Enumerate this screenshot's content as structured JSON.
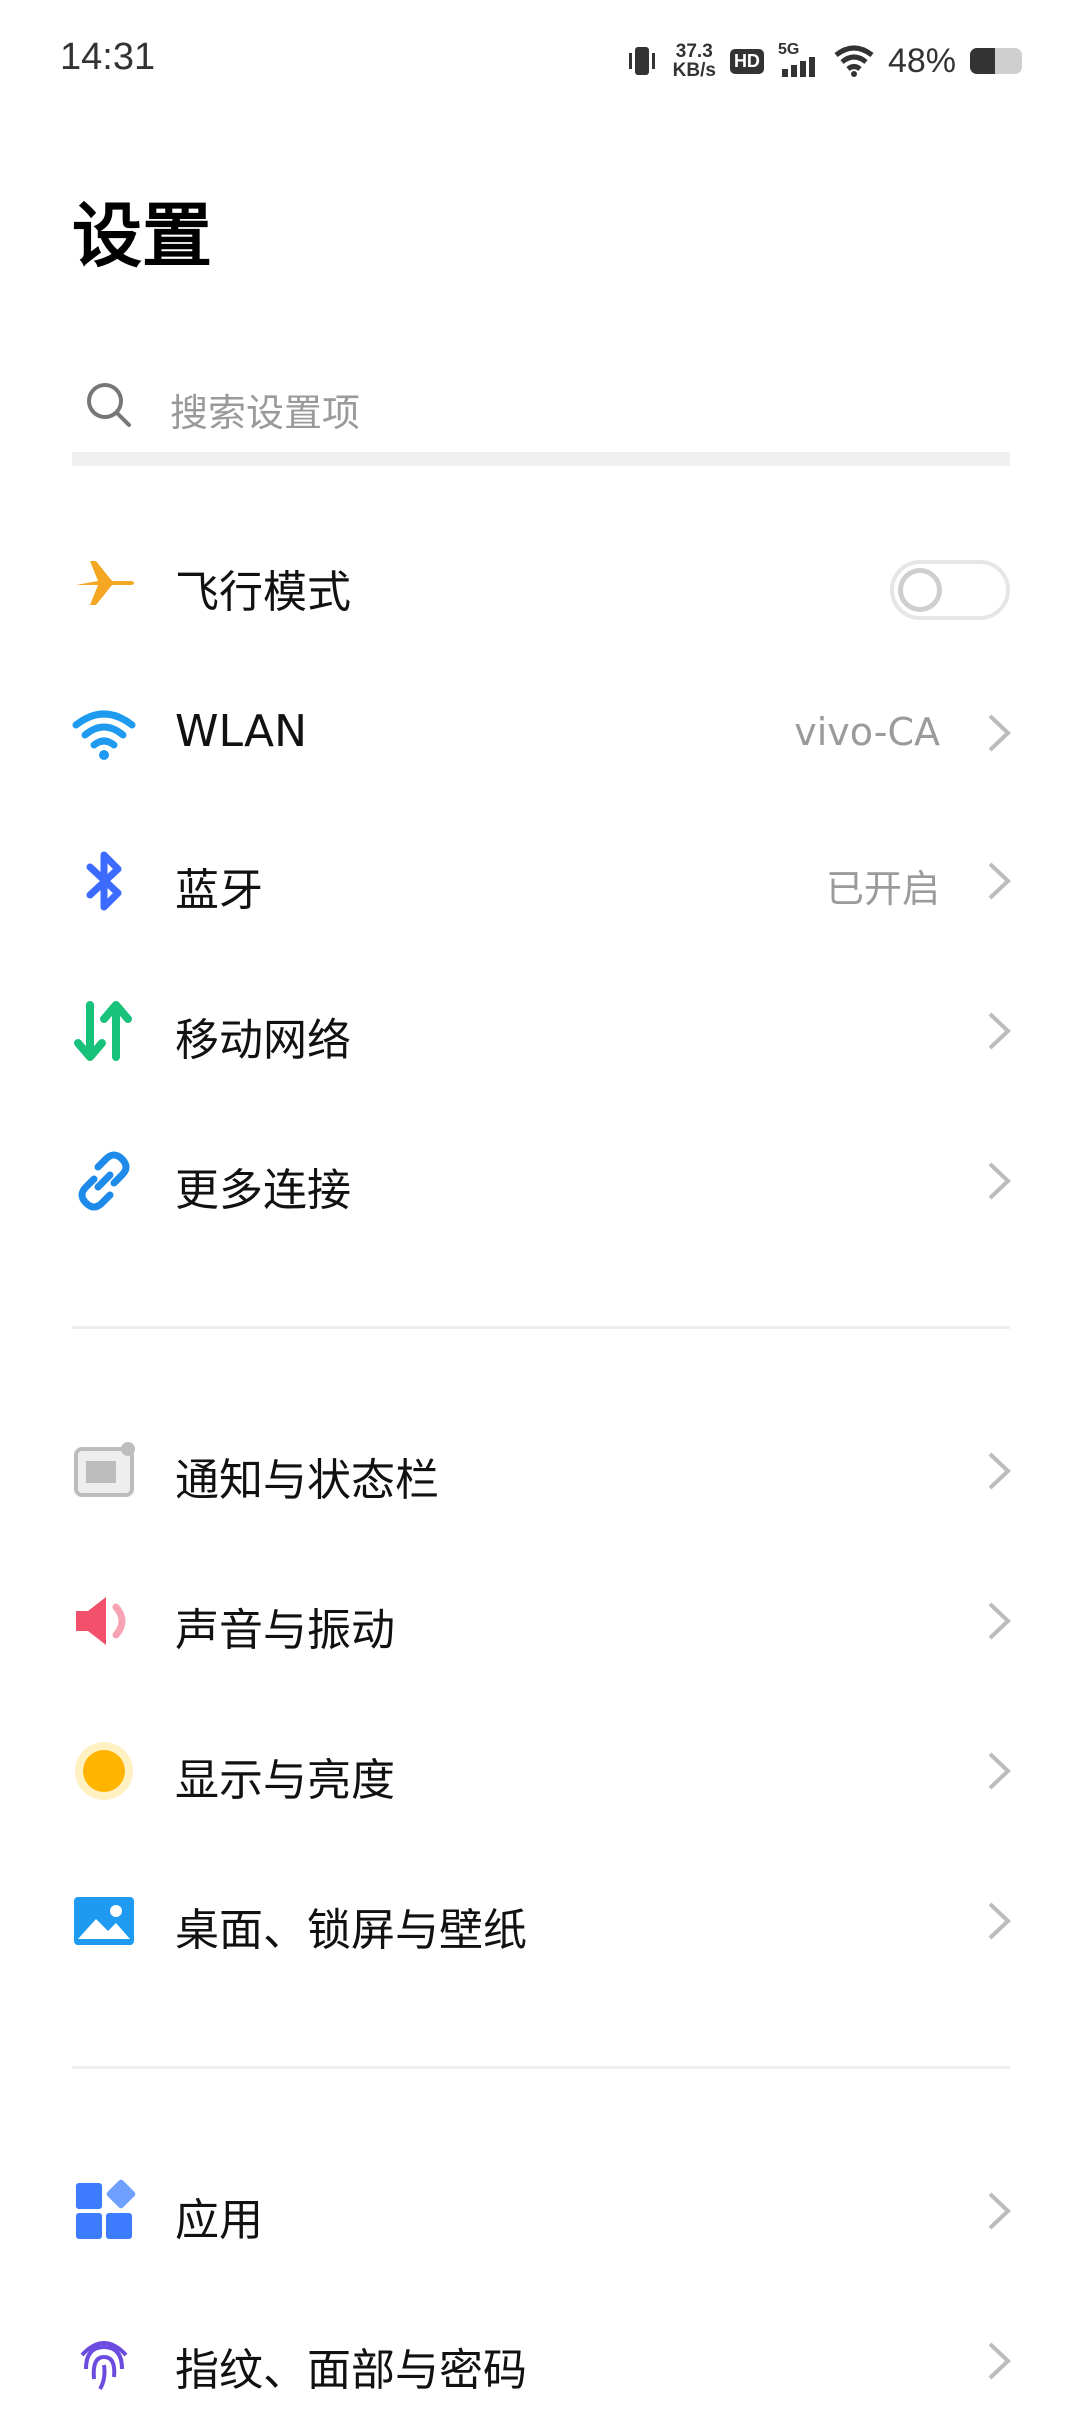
{
  "status": {
    "time": "14:31",
    "net_speed_top": "37.3",
    "net_speed_bottom": "KB/s",
    "hd": "HD",
    "network": "5G",
    "battery_pct": "48%",
    "battery_level": 0.48
  },
  "page": {
    "title": "设置"
  },
  "search": {
    "placeholder": "搜索设置项"
  },
  "groups": [
    {
      "items": [
        {
          "label": "飞行模式",
          "icon": "airplane-icon",
          "type": "toggle",
          "on": false
        },
        {
          "label": "WLAN",
          "icon": "wifi-icon",
          "value": "vivo-CA"
        },
        {
          "label": "蓝牙",
          "icon": "bluetooth-icon",
          "value": "已开启"
        },
        {
          "label": "移动网络",
          "icon": "mobile-network-icon"
        },
        {
          "label": "更多连接",
          "icon": "link-icon"
        }
      ]
    },
    {
      "items": [
        {
          "label": "通知与状态栏",
          "icon": "notification-icon"
        },
        {
          "label": "声音与振动",
          "icon": "sound-icon"
        },
        {
          "label": "显示与亮度",
          "icon": "brightness-icon"
        },
        {
          "label": "桌面、锁屏与壁纸",
          "icon": "wallpaper-icon"
        }
      ]
    },
    {
      "items": [
        {
          "label": "应用",
          "icon": "apps-icon"
        },
        {
          "label": "指纹、面部与密码",
          "icon": "fingerprint-icon"
        }
      ]
    }
  ],
  "colors": {
    "airplane": "#F5A623",
    "wifi": "#1E9BF0",
    "bluetooth": "#3D6BFF",
    "mobile": "#18C27A",
    "link": "#1E8BEA",
    "notification": "#BDBDBD",
    "sound": "#F2506B",
    "brightness": "#FFB400",
    "wallpaper": "#1E9BF0",
    "apps": "#3D7BFF",
    "fingerprint": "#6C4CE0"
  }
}
